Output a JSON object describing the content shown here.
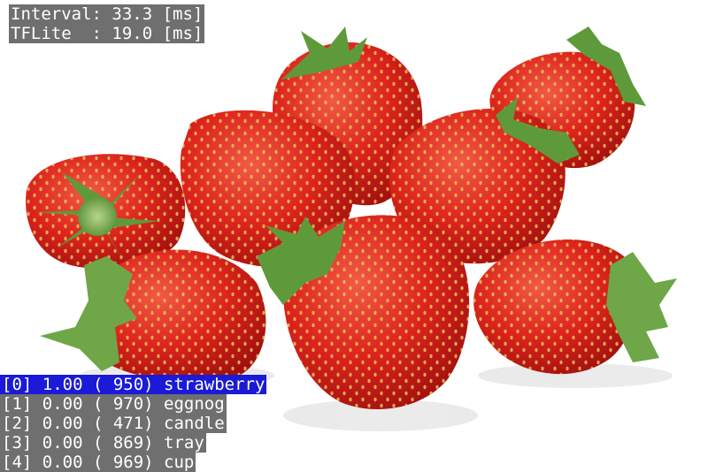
{
  "hud": {
    "interval": "Interval: 33.3 [ms]",
    "tflite": "TFLite  : 19.0 [ms]"
  },
  "results": [
    "[0] 1.00 ( 950) strawberry",
    "[1] 0.00 ( 970) eggnog",
    "[2] 0.00 ( 471) candle",
    "[3] 0.00 ( 869) tray",
    "[4] 0.00 ( 969) cup"
  ],
  "colors": {
    "hud_bg": "#6f6f6f",
    "top_result_bg": "#1a1ad8",
    "text": "#ffffff",
    "berry": "#d8201c",
    "leaf": "#5f9a3a"
  },
  "image": {
    "subject": "strawberries"
  }
}
